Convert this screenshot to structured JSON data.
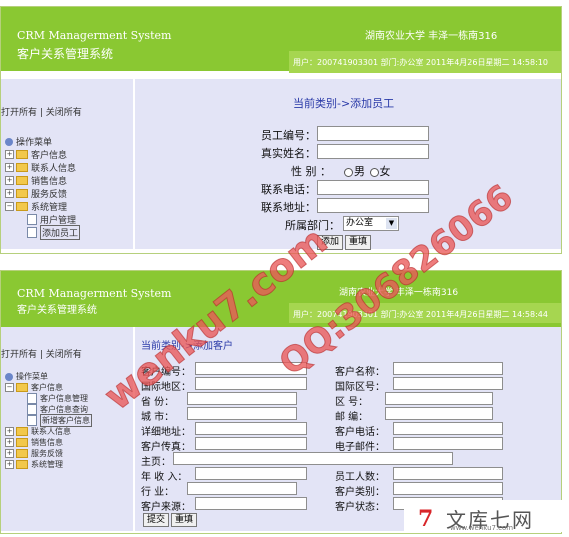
{
  "header": {
    "brand_en": "CRM Managerment System",
    "brand_cn": "客户关系管理系统",
    "school": "湖南农业大学 丰泽一栋南316"
  },
  "panel1": {
    "userline": "用户：200741903301 部门:办公室  2011年4月26日星期二  14:58:10",
    "toggle_text": "打开所有 | 关闭所有",
    "tree": {
      "root": "操作菜单",
      "items": [
        "客户信息",
        "联系人信息",
        "销售信息",
        "服务反馈",
        "系统管理"
      ],
      "sub": [
        "用户管理",
        "添加员工"
      ]
    },
    "crumb": "当前类别->添加员工",
    "labels": {
      "emp_id": "员工编号：",
      "real_name": "真实姓名：",
      "gender": "性    别  ：",
      "male": "男",
      "female": "女",
      "phone": "联系电话：",
      "address": "联系地址：",
      "dept": "所属部门：",
      "dept_value": "办公室"
    },
    "buttons": {
      "add": "添加",
      "reset": "重填"
    }
  },
  "panel2": {
    "userline": "用户：200741903301 部门:办公室  2011年4月26日星期二  14:58:44",
    "toggle_text": "打开所有 | 关闭所有",
    "tree": {
      "root": "操作菜单",
      "group": "客户信息",
      "sub": [
        "客户信息管理",
        "客户信息查询",
        "新增客户信息"
      ],
      "items": [
        "联系人信息",
        "销售信息",
        "服务反馈",
        "系统管理"
      ]
    },
    "crumb": "当前类别->添加客户",
    "labels": {
      "cust_id": "客户编号：",
      "cust_name": "客户名称：",
      "country": "国际地区：",
      "country_code": "国际区号：",
      "province": "省    份：",
      "area_code": "区    号：",
      "city": "城    市：",
      "zip": "邮    编：",
      "address": "详细地址：",
      "phone": "客户电话：",
      "fax": "客户传真：",
      "email": "电子邮件：",
      "homepage": "主页：",
      "revenue": "年  收 入：",
      "staff": "员工人数：",
      "industry": "行    业：",
      "category": "客户类别：",
      "source": "客户来源：",
      "status": "客户状态："
    },
    "buttons": {
      "submit": "提交",
      "reset": "重填"
    }
  },
  "watermark": {
    "site": "wenku7.com",
    "qq": "QQ:306826066"
  },
  "logo": {
    "mark": "7",
    "text": "文库七网",
    "sub": "www.wenku7.com"
  }
}
